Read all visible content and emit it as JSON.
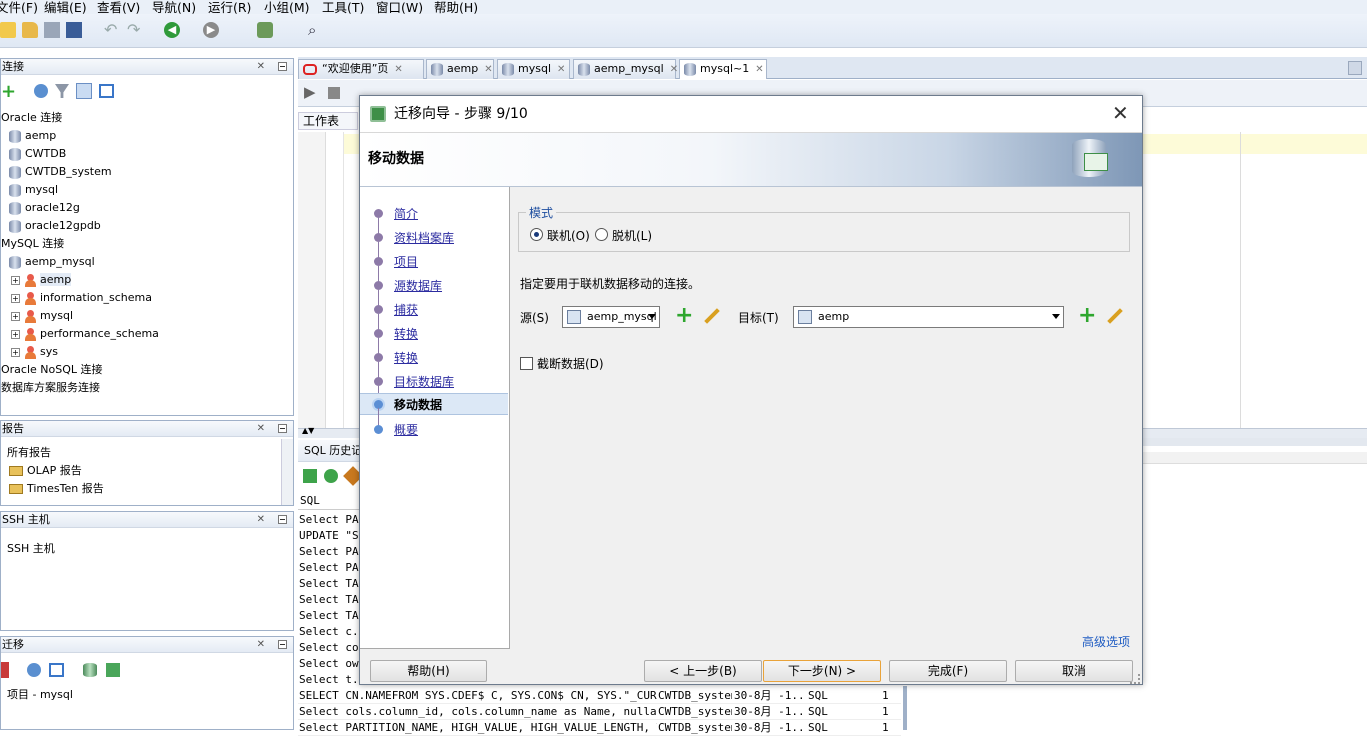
{
  "menubar": [
    "文件(F)",
    "编辑(E)",
    "查看(V)",
    "导航(N)",
    "运行(R)",
    "小组(M)",
    "工具(T)",
    "窗口(W)",
    "帮助(H)"
  ],
  "connections": {
    "title": "连接",
    "items": [
      {
        "label": "Oracle 连接",
        "indent": 0
      },
      {
        "label": "aemp",
        "indent": 1
      },
      {
        "label": "CWTDB",
        "indent": 1
      },
      {
        "label": "CWTDB_system",
        "indent": 1
      },
      {
        "label": "mysql",
        "indent": 1
      },
      {
        "label": "oracle12g",
        "indent": 1
      },
      {
        "label": "oracle12gpdb",
        "indent": 1
      },
      {
        "label": "MySQL 连接",
        "indent": 0
      },
      {
        "label": "aemp_mysql",
        "indent": 1
      },
      {
        "label": "aemp",
        "indent": 2
      },
      {
        "label": "information_schema",
        "indent": 2
      },
      {
        "label": "mysql",
        "indent": 2
      },
      {
        "label": "performance_schema",
        "indent": 2
      },
      {
        "label": "sys",
        "indent": 2
      },
      {
        "label": "Oracle NoSQL 连接",
        "indent": 0
      },
      {
        "label": "数据库方案服务连接",
        "indent": 0
      }
    ]
  },
  "reports": {
    "title": "报告",
    "items": [
      "所有报告",
      "OLAP 报告",
      "TimesTen 报告"
    ]
  },
  "ssh": {
    "title": "SSH 主机",
    "item": "SSH 主机"
  },
  "migration": {
    "title": "迁移",
    "item": "项目 - mysql"
  },
  "tabs": [
    "“欢迎使用”页",
    "aemp",
    "mysql",
    "aemp_mysql",
    "mysql~1"
  ],
  "editor": {
    "worksheet_tab": "工作表"
  },
  "history": {
    "title": "SQL 历史记录",
    "col_sql": "SQL",
    "rows_left": [
      "Select PAR",
      "UPDATE \"SY",
      "Select PAR",
      "Select PAR",
      "Select  TA",
      "Select  TA",
      "Select  TA",
      "Select c.c",
      "Select col",
      "Select own",
      "Select t.t"
    ],
    "rows_full": [
      {
        "sql": "SELECT CN.NAMEFROM   SYS.CDEF$ C, SYS.CON$ CN, SYS.\"_CUR...",
        "conn": "CWTDB_system",
        "date": "30-8月 -1...",
        "type": "SQL",
        "n": "1"
      },
      {
        "sql": "Select cols.column_id, cols.column_name as Name, nullabl...",
        "conn": "CWTDB_system",
        "date": "30-8月 -1...",
        "type": "SQL",
        "n": "1"
      },
      {
        "sql": "Select PARTITION_NAME,  HIGH_VALUE, HIGH_VALUE_LENGTH, T...",
        "conn": "CWTDB_system",
        "date": "30-8月 -1...",
        "type": "SQL",
        "n": "1"
      }
    ]
  },
  "dialog": {
    "title": "迁移向导 - 步骤 9/10",
    "banner_title": "移动数据",
    "steps": [
      "简介",
      "资料档案库",
      "项目",
      "源数据库",
      "捕获",
      "转换",
      "转换",
      "目标数据库",
      "移动数据",
      "概要"
    ],
    "current_step": 8,
    "mode_legend": "模式",
    "mode_online": "联机(O)",
    "mode_offline": "脱机(L)",
    "instruction": "指定要用于联机数据移动的连接。",
    "source_label": "源(S)",
    "source_value": "aemp_mysql",
    "target_label": "目标(T)",
    "target_value": "aemp",
    "truncate_label": "截断数据(D)",
    "advanced_link": "高级选项",
    "btn_help": "帮助(H)",
    "btn_back": "< 上一步(B)",
    "btn_next": "下一步(N) >",
    "btn_finish": "完成(F)",
    "btn_cancel": "取消"
  },
  "colors": {
    "accent": "#2c2ca0",
    "link": "#1f5cc2",
    "selection": "#dce8f6",
    "default_button_border": "#e9a33a"
  }
}
